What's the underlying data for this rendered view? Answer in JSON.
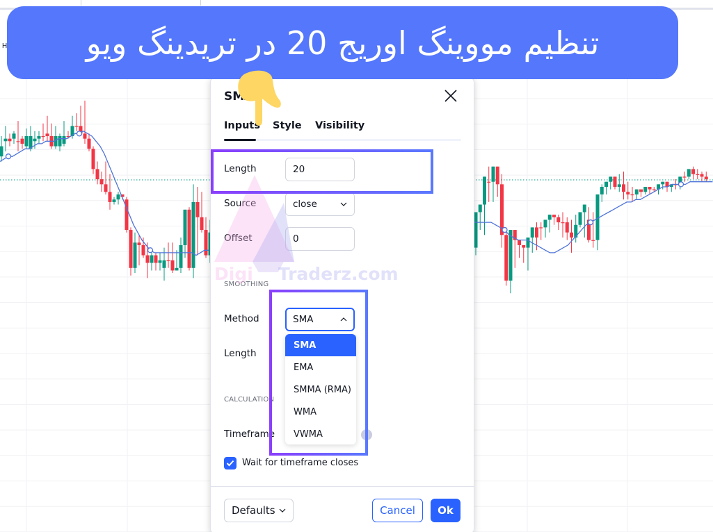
{
  "banner": {
    "text": "تنظیم مووینگ اوریج 20 در تریدینگ ویو",
    "bg_color": "#5477fb"
  },
  "chart": {
    "symbol_letter": "H",
    "up_color": "#089981",
    "down_color": "#f23645",
    "ma_color": "#4f74d9",
    "grid_color": "#f0f1f4",
    "price_line_color": "#089981",
    "candles_left": [
      {
        "o": 60,
        "h": 52,
        "c": 56,
        "l": 62
      },
      {
        "o": 54,
        "h": 48,
        "c": 53,
        "l": 58
      },
      {
        "o": 53,
        "h": 51,
        "c": 54,
        "l": 56
      },
      {
        "o": 53,
        "h": 50,
        "c": 51,
        "l": 55
      },
      {
        "o": 54,
        "h": 46,
        "c": 54,
        "l": 58
      },
      {
        "o": 53,
        "h": 52,
        "c": 55,
        "l": 57
      },
      {
        "o": 56,
        "h": 49,
        "c": 52,
        "l": 57
      },
      {
        "o": 57,
        "h": 48,
        "c": 52,
        "l": 58
      },
      {
        "o": 54,
        "h": 50,
        "c": 53,
        "l": 57
      },
      {
        "o": 53,
        "h": 50,
        "c": 52,
        "l": 55
      },
      {
        "o": 52,
        "h": 47,
        "c": 52,
        "l": 54
      },
      {
        "o": 51,
        "h": 44,
        "c": 52,
        "l": 54
      },
      {
        "o": 52,
        "h": 47,
        "c": 56,
        "l": 57
      },
      {
        "o": 56,
        "h": 48,
        "c": 52,
        "l": 57
      },
      {
        "o": 56,
        "h": 51,
        "c": 52,
        "l": 58
      },
      {
        "o": 55,
        "h": 46,
        "c": 52,
        "l": 56
      },
      {
        "o": 52,
        "h": 50,
        "c": 52,
        "l": 53
      },
      {
        "o": 52,
        "h": 44,
        "c": 48,
        "l": 53
      },
      {
        "o": 48,
        "h": 43,
        "c": 48,
        "l": 50
      },
      {
        "o": 48,
        "h": 40,
        "c": 51,
        "l": 52
      },
      {
        "o": 51,
        "h": 38,
        "c": 53,
        "l": 55
      },
      {
        "o": 53,
        "h": 51,
        "c": 57,
        "l": 58
      },
      {
        "o": 57,
        "h": 56,
        "c": 65,
        "l": 67
      },
      {
        "o": 65,
        "h": 62,
        "c": 69,
        "l": 71
      },
      {
        "o": 69,
        "h": 66,
        "c": 71,
        "l": 74
      },
      {
        "o": 71,
        "h": 62,
        "c": 74,
        "l": 75
      },
      {
        "o": 74,
        "h": 67,
        "c": 78,
        "l": 81
      },
      {
        "o": 78,
        "h": 76,
        "c": 77,
        "l": 79
      },
      {
        "o": 77,
        "h": 74,
        "c": 75,
        "l": 79
      },
      {
        "o": 75,
        "h": 76,
        "c": 76,
        "l": 77
      },
      {
        "o": 77,
        "h": 76,
        "c": 89,
        "l": 90
      },
      {
        "o": 89,
        "h": 88,
        "c": 104,
        "l": 107
      },
      {
        "o": 104,
        "h": 90,
        "c": 94,
        "l": 106
      },
      {
        "o": 94,
        "h": 91,
        "c": 95,
        "l": 103
      },
      {
        "o": 95,
        "h": 92,
        "c": 99,
        "l": 100
      },
      {
        "o": 99,
        "h": 94,
        "c": 102,
        "l": 108
      },
      {
        "o": 102,
        "h": 97,
        "c": 99,
        "l": 105
      },
      {
        "o": 99,
        "h": 98,
        "c": 102,
        "l": 105
      },
      {
        "o": 102,
        "h": 98,
        "c": 101,
        "l": 105
      },
      {
        "o": 104,
        "h": 96,
        "c": 101,
        "l": 109
      },
      {
        "o": 101,
        "h": 94,
        "c": 101,
        "l": 104
      },
      {
        "o": 101,
        "h": 94,
        "c": 105,
        "l": 106
      },
      {
        "o": 105,
        "h": 97,
        "c": 104,
        "l": 105
      },
      {
        "o": 104,
        "h": 92,
        "c": 95,
        "l": 106
      },
      {
        "o": 95,
        "h": 81,
        "c": 81,
        "l": 100
      },
      {
        "o": 81,
        "h": 80,
        "c": 104,
        "l": 105
      },
      {
        "o": 104,
        "h": 71,
        "c": 78,
        "l": 108
      },
      {
        "o": 78,
        "h": 72,
        "c": 84,
        "l": 99
      },
      {
        "o": 84,
        "h": 74,
        "c": 89,
        "l": 90
      },
      {
        "o": 89,
        "h": 84,
        "c": 99,
        "l": 100
      },
      {
        "o": 99,
        "h": 85,
        "c": 90,
        "l": 102
      }
    ],
    "ma_left": [
      62,
      61,
      60,
      60,
      59,
      58,
      57,
      57,
      56,
      55,
      55,
      54,
      54,
      54,
      53,
      53,
      53,
      52,
      51,
      51,
      50,
      51,
      52,
      54,
      56,
      59,
      63,
      67,
      71,
      75,
      79,
      83,
      87,
      90,
      93,
      95,
      97,
      98,
      98,
      98,
      98,
      98,
      98,
      98,
      98,
      98,
      98,
      99,
      98,
      97,
      97
    ],
    "candles_right": [
      {
        "o": 96,
        "h": 82,
        "c": 82,
        "l": 99
      },
      {
        "o": 82,
        "h": 79,
        "c": 79,
        "l": 89
      },
      {
        "o": 79,
        "h": 68,
        "c": 68,
        "l": 91
      },
      {
        "o": 70,
        "h": 64,
        "c": 70,
        "l": 78
      },
      {
        "o": 70,
        "h": 65,
        "c": 64,
        "l": 78
      },
      {
        "o": 64,
        "h": 64,
        "c": 71,
        "l": 76
      },
      {
        "o": 71,
        "h": 67,
        "c": 91,
        "l": 96
      },
      {
        "o": 91,
        "h": 88,
        "c": 109,
        "l": 111
      },
      {
        "o": 109,
        "h": 89,
        "c": 89,
        "l": 114
      },
      {
        "o": 89,
        "h": 93,
        "c": 93,
        "l": 104
      },
      {
        "o": 93,
        "h": 95,
        "c": 95,
        "l": 100
      },
      {
        "o": 95,
        "h": 95,
        "c": 96,
        "l": 102
      },
      {
        "o": 96,
        "h": 92,
        "c": 92,
        "l": 105
      },
      {
        "o": 92,
        "h": 88,
        "c": 88,
        "l": 98
      },
      {
        "o": 88,
        "h": 86,
        "c": 92,
        "l": 97
      },
      {
        "o": 88,
        "h": 86,
        "c": 88,
        "l": 93
      },
      {
        "o": 88,
        "h": 89,
        "c": 85,
        "l": 92
      },
      {
        "o": 85,
        "h": 83,
        "c": 83,
        "l": 90
      },
      {
        "o": 83,
        "h": 84,
        "c": 84,
        "l": 87
      },
      {
        "o": 84,
        "h": 83,
        "c": 86,
        "l": 89
      },
      {
        "o": 86,
        "h": 82,
        "c": 86,
        "l": 92
      },
      {
        "o": 86,
        "h": 84,
        "c": 90,
        "l": 93
      },
      {
        "o": 90,
        "h": 85,
        "c": 92,
        "l": 98
      },
      {
        "o": 92,
        "h": 83,
        "c": 87,
        "l": 94
      },
      {
        "o": 87,
        "h": 82,
        "c": 82,
        "l": 88
      },
      {
        "o": 82,
        "h": 79,
        "c": 79,
        "l": 92
      },
      {
        "o": 85,
        "h": 80,
        "c": 93,
        "l": 94
      },
      {
        "o": 93,
        "h": 82,
        "c": 93,
        "l": 96
      },
      {
        "o": 93,
        "h": 75,
        "c": 75,
        "l": 97
      },
      {
        "o": 75,
        "h": 71,
        "c": 72,
        "l": 78
      },
      {
        "o": 72,
        "h": 70,
        "c": 70,
        "l": 75
      },
      {
        "o": 70,
        "h": 68,
        "c": 68,
        "l": 73
      },
      {
        "o": 68,
        "h": 69,
        "c": 72,
        "l": 73
      },
      {
        "o": 72,
        "h": 67,
        "c": 71,
        "l": 74
      },
      {
        "o": 71,
        "h": 66,
        "c": 74,
        "l": 77
      },
      {
        "o": 74,
        "h": 70,
        "c": 75,
        "l": 77
      },
      {
        "o": 75,
        "h": 72,
        "c": 75,
        "l": 78
      },
      {
        "o": 75,
        "h": 73,
        "c": 73,
        "l": 77
      },
      {
        "o": 73,
        "h": 75,
        "c": 74,
        "l": 76
      },
      {
        "o": 74,
        "h": 72,
        "c": 72,
        "l": 75
      },
      {
        "o": 72,
        "h": 72,
        "c": 73,
        "l": 75
      },
      {
        "o": 73,
        "h": 72,
        "c": 73,
        "l": 74
      },
      {
        "o": 73,
        "h": 71,
        "c": 71,
        "l": 75
      },
      {
        "o": 71,
        "h": 70,
        "c": 70,
        "l": 73
      },
      {
        "o": 70,
        "h": 70,
        "c": 72,
        "l": 74
      },
      {
        "o": 72,
        "h": 71,
        "c": 71,
        "l": 74
      },
      {
        "o": 71,
        "h": 69,
        "c": 71,
        "l": 73
      },
      {
        "o": 71,
        "h": 68,
        "c": 68,
        "l": 73
      },
      {
        "o": 68,
        "h": 66,
        "c": 68,
        "l": 70
      },
      {
        "o": 68,
        "h": 65,
        "c": 65,
        "l": 69
      },
      {
        "o": 65,
        "h": 64,
        "c": 67,
        "l": 69
      },
      {
        "o": 67,
        "h": 65,
        "c": 67,
        "l": 69
      },
      {
        "o": 67,
        "h": 66,
        "c": 68,
        "l": 70
      },
      {
        "o": 68,
        "h": 66,
        "c": 69,
        "l": 70
      }
    ],
    "ma_right": [
      86,
      86,
      86,
      86,
      86,
      87,
      88,
      89,
      91,
      92,
      93,
      93,
      93,
      94,
      95,
      96,
      97,
      98,
      98,
      97,
      96,
      95,
      93,
      91,
      89,
      87,
      86,
      85,
      84,
      83,
      82,
      81,
      80,
      79,
      78,
      78,
      77,
      77,
      76,
      75,
      74,
      73,
      72,
      72,
      71,
      71,
      71,
      71,
      70,
      70,
      70,
      70,
      70,
      70
    ],
    "ma_markers_left": [
      2,
      19,
      36
    ],
    "ma_markers_right": [
      7,
      26,
      46
    ],
    "price_line_value": 58
  },
  "dialog": {
    "title": "SMA",
    "tabs": [
      {
        "label": "Inputs",
        "active": true
      },
      {
        "label": "Style",
        "active": false
      },
      {
        "label": "Visibility",
        "active": false
      }
    ],
    "inputs": {
      "length_label": "Length",
      "length_value": "20",
      "source_label": "Source",
      "source_value": "close",
      "offset_label": "Offset",
      "offset_value": "0"
    },
    "smoothing": {
      "section_label": "SMOOTHING",
      "method_label": "Method",
      "method_value": "SMA",
      "length_label": "Length",
      "method_options": [
        "SMA",
        "EMA",
        "SMMA (RMA)",
        "WMA",
        "VWMA"
      ],
      "selected_option": "SMA"
    },
    "calculation": {
      "section_label": "CALCULATION",
      "timeframe_label": "Timeframe",
      "wait_label": "Wait for timeframe closes",
      "wait_checked": true
    },
    "footer": {
      "defaults_label": "Defaults",
      "cancel_label": "Cancel",
      "ok_label": "Ok"
    }
  },
  "watermark": {
    "part1": "Digi",
    "part2": "Traderz.com"
  },
  "highlight_color": "#7a4bff"
}
